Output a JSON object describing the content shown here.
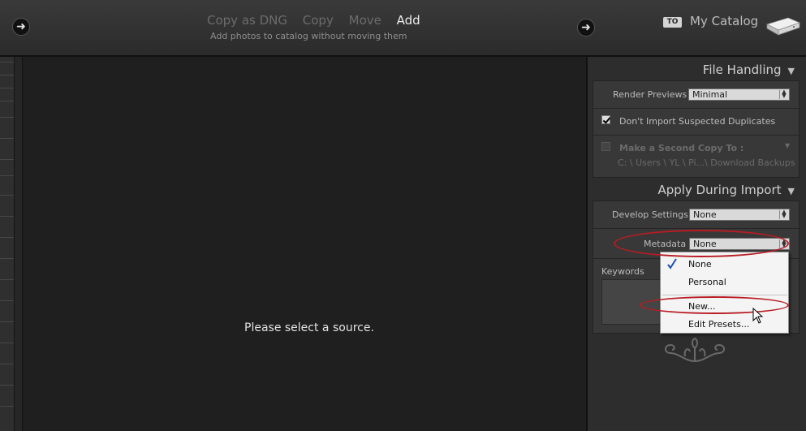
{
  "topbar": {
    "modes": [
      "Copy as DNG",
      "Copy",
      "Move",
      "Add"
    ],
    "active_mode": "Add",
    "mode_description": "Add photos to catalog without moving them",
    "destination_badge": "TO",
    "destination_name": "My Catalog",
    "icons": {
      "back": "arrow-right-circle-icon",
      "forward": "arrow-right-circle-icon",
      "drive": "hard-drive-icon"
    }
  },
  "center": {
    "message": "Please select a source."
  },
  "file_handling": {
    "title": "File Handling",
    "render_previews_label": "Render Previews",
    "render_previews_value": "Minimal",
    "dont_import_duplicates_label": "Don't Import Suspected Duplicates",
    "dont_import_duplicates_checked": true,
    "second_copy_label": "Make a Second Copy To :",
    "second_copy_checked": false,
    "second_copy_path": "C: \\ Users \\ YL \\ Pi...\\ Download Backups"
  },
  "apply_during_import": {
    "title": "Apply During Import",
    "develop_settings_label": "Develop Settings",
    "develop_settings_value": "None",
    "metadata_label": "Metadata",
    "metadata_value": "None",
    "keywords_label": "Keywords"
  },
  "metadata_menu": {
    "items": [
      "None",
      "Personal",
      "New...",
      "Edit Presets..."
    ],
    "checked_item": "None"
  },
  "colors": {
    "annotation_red": "#b81c24",
    "panel_bg": "#2d2d2d",
    "center_bg": "#1f1f1f"
  }
}
